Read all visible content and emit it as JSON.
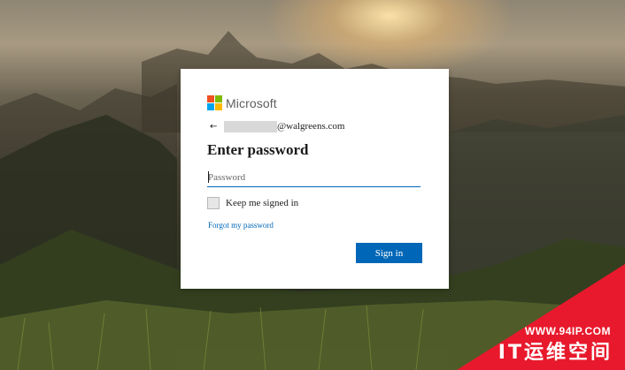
{
  "brand": {
    "name": "Microsoft",
    "logo_colors": [
      "#f25022",
      "#7fba00",
      "#00a4ef",
      "#ffb900"
    ]
  },
  "identity": {
    "back_icon": "←",
    "email_suffix": "@walgreens.com"
  },
  "title": "Enter password",
  "password": {
    "placeholder": "Password",
    "value": ""
  },
  "keep_signed_in": {
    "label": "Keep me signed in",
    "checked": false
  },
  "forgot_password": "Forgot my password",
  "sign_in_label": "Sign in",
  "accent_color": "#0067b8",
  "watermark": {
    "url": "WWW.94IP.COM",
    "title": "IT运维空间",
    "color": "#e8192c"
  }
}
